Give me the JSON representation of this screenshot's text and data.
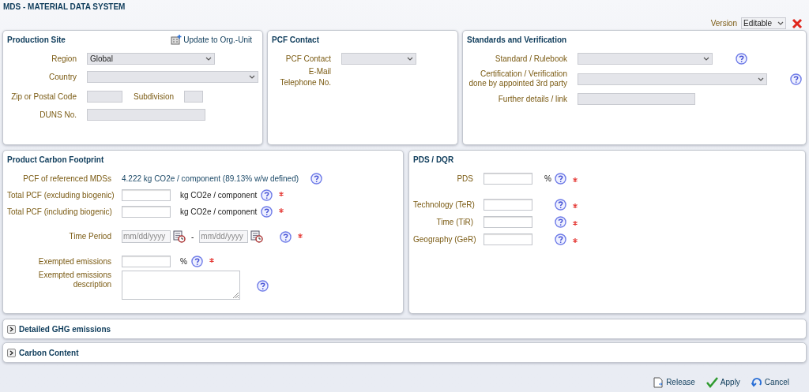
{
  "header": {
    "title": "MDS - MATERIAL DATA SYSTEM",
    "version_label": "Version",
    "version_value": "Editable"
  },
  "production_site": {
    "title": "Production Site",
    "action": "Update to Org.-Unit",
    "region": {
      "label": "Region",
      "value": "Global"
    },
    "country": {
      "label": "Country"
    },
    "zip": {
      "label": "Zip or Postal Code"
    },
    "subdivision": {
      "label": "Subdivision"
    },
    "duns": {
      "label": "DUNS No."
    }
  },
  "pcf_contact": {
    "title": "PCF Contact",
    "contact": {
      "label": "PCF Contact"
    },
    "email": {
      "label": "E-Mail"
    },
    "telephone": {
      "label": "Telephone No."
    }
  },
  "standards": {
    "title": "Standards and Verification",
    "rows": [
      {
        "kind": "select",
        "label_lines": [
          "Standard / Rulebook"
        ],
        "help": true
      },
      {
        "kind": "select",
        "label_lines": [
          "Certification / Verification",
          "done by appointed 3rd party"
        ],
        "help": true
      },
      {
        "kind": "text",
        "label_lines": [
          "Further details / link"
        ],
        "help": false
      }
    ]
  },
  "product_carbon_footprint": {
    "title": "Product Carbon Footprint",
    "rows": [
      {
        "kind": "readout",
        "label_lines": [
          "PCF of referenced MDSs"
        ],
        "value": "4.222 kg CO2e / component (89.13% w/w defined)",
        "help": true,
        "required": false
      },
      {
        "kind": "number",
        "label_lines": [
          "Total PCF (excluding biogenic)"
        ],
        "unit": "kg CO2e / component",
        "help": true,
        "required": true
      },
      {
        "kind": "number",
        "label_lines": [
          "Total PCF (including biogenic)"
        ],
        "unit": "kg CO2e / component",
        "help": true,
        "required": true
      },
      {
        "kind": "date_range",
        "label_lines": [
          "Time Period"
        ],
        "from_placeholder": "mm/dd/yyyy",
        "separator": "-",
        "to_placeholder": "mm/dd/yyyy",
        "help": true,
        "required": true
      },
      {
        "kind": "number",
        "label_lines": [
          "Exempted emissions"
        ],
        "unit": "%",
        "help": true,
        "required": true
      },
      {
        "kind": "textarea",
        "label_lines": [
          "Exempted emissions",
          "description"
        ],
        "help": true,
        "required": false
      }
    ]
  },
  "pds_dqr": {
    "title": "PDS / DQR",
    "rows": [
      {
        "label": "PDS",
        "unit": "%",
        "help": true,
        "required": true
      },
      {
        "label": "Technology (TeR)",
        "help": true,
        "required": true
      },
      {
        "label": "Time (TiR)",
        "help": true,
        "required": true
      },
      {
        "label": "Geography (GeR)",
        "help": true,
        "required": true
      }
    ]
  },
  "sections": [
    {
      "title": "Detailed GHG emissions",
      "expanded": false
    },
    {
      "title": "Carbon Content",
      "expanded": false
    }
  ],
  "actions": [
    {
      "kind": "release",
      "label": "Release"
    },
    {
      "kind": "apply",
      "label": "Apply"
    },
    {
      "kind": "cancel",
      "label": "Cancel"
    }
  ]
}
